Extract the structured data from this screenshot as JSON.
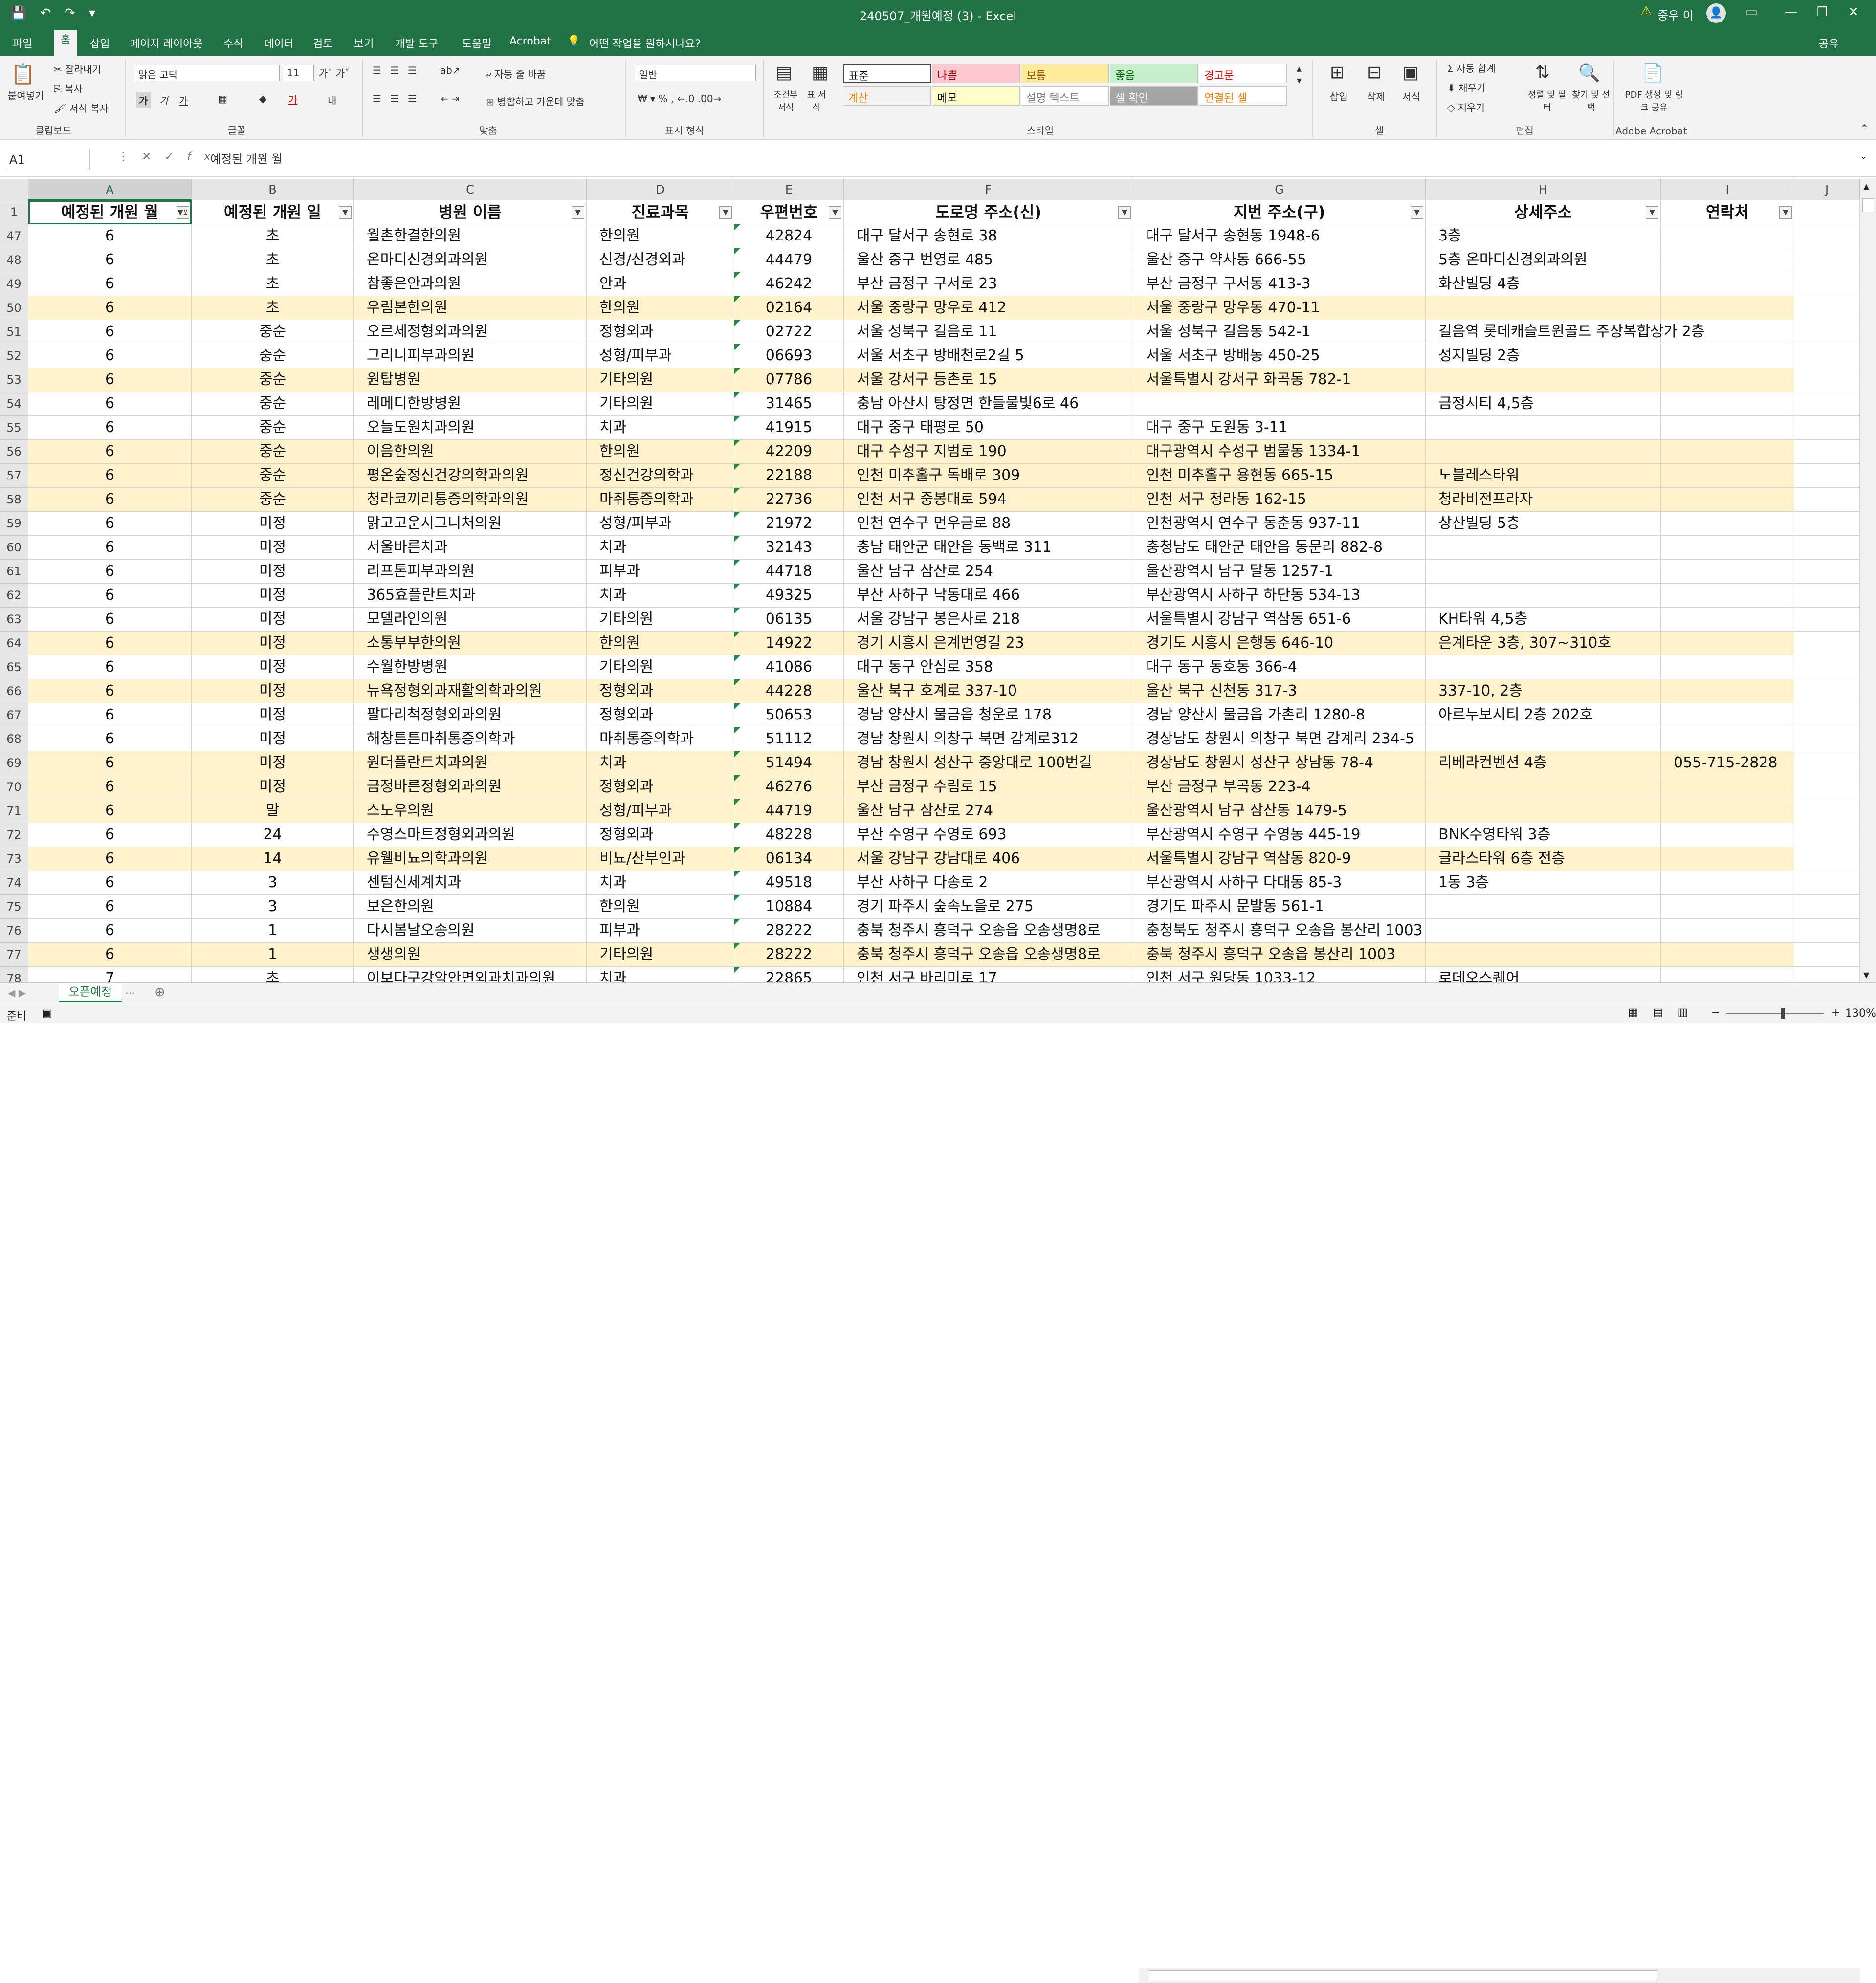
{
  "window": {
    "title": "240507_개원예정 (3)  -  Excel",
    "user": "중우 이",
    "qat_icons": [
      "save-icon",
      "undo-icon",
      "redo-icon"
    ]
  },
  "menu": [
    "파일",
    "홈",
    "삽입",
    "페이지 레이아웃",
    "수식",
    "데이터",
    "검토",
    "보기",
    "개발 도구",
    "도움말",
    "Acrobat",
    "어떤 작업을 원하시나요?",
    "공유"
  ],
  "ribbon": {
    "clipboard": {
      "paste": "붙여넣기",
      "cut": "잘라내기",
      "copy": "복사",
      "format_painter": "서식 복사",
      "group": "클립보드"
    },
    "font": {
      "name": "맑은 고딕",
      "size": "11",
      "group": "글꼴"
    },
    "align": {
      "wrap": "자동 줄 바꿈",
      "merge": "병합하고 가운데 맞춤",
      "group": "맞춤"
    },
    "number": {
      "format": "일반",
      "group": "표시 형식"
    },
    "styles": {
      "cond": "조건부 서식",
      "table": "표 서식",
      "group": "스타일",
      "cells": [
        {
          "label": "표준",
          "bg": "#ffffff",
          "fg": "#000000"
        },
        {
          "label": "나쁨",
          "bg": "#ffc7ce",
          "fg": "#9c0006"
        },
        {
          "label": "보통",
          "bg": "#ffeb9c",
          "fg": "#9c5700"
        },
        {
          "label": "좋음",
          "bg": "#c6efce",
          "fg": "#006100"
        },
        {
          "label": "경고문",
          "bg": "#ffffff",
          "fg": "#ff0000"
        },
        {
          "label": "계산",
          "bg": "#f2f2f2",
          "fg": "#fa7d00"
        },
        {
          "label": "메모",
          "bg": "#ffffcc",
          "fg": "#000000"
        },
        {
          "label": "설명 텍스트",
          "bg": "#ffffff",
          "fg": "#7f7f7f"
        },
        {
          "label": "셀 확인",
          "bg": "#a5a5a5",
          "fg": "#ffffff"
        },
        {
          "label": "연결된 셀",
          "bg": "#ffffff",
          "fg": "#fa7d00"
        }
      ]
    },
    "cells": {
      "insert": "삽입",
      "delete": "삭제",
      "format": "서식",
      "group": "셀"
    },
    "editing": {
      "autosum": "자동 합계",
      "fill": "채우기",
      "clear": "지우기",
      "sort": "정렬 및 필터",
      "find": "찾기 및 선택",
      "group": "편집"
    },
    "acrobat": {
      "pdf": "PDF 생성 및 링크 공유",
      "group": "Adobe Acrobat"
    }
  },
  "formula_bar": {
    "name_box": "A1",
    "formula": "예정된 개원 월"
  },
  "columns": [
    "A",
    "B",
    "C",
    "D",
    "E",
    "F",
    "G",
    "H",
    "I",
    "J"
  ],
  "headers": [
    "예정된 개원 월",
    "예정된 개원 일",
    "병원 이름",
    "진료과목",
    "우편번호",
    "도로명 주소(신)",
    "지번 주소(구)",
    "상세주소",
    "연락처"
  ],
  "rows": [
    {
      "n": "47",
      "hl": false,
      "c": [
        "6",
        "초",
        "월촌한결한의원",
        "한의원",
        "42824",
        "대구 달서구 송현로 38",
        "대구 달서구 송현동 1948-6",
        "3층",
        ""
      ]
    },
    {
      "n": "48",
      "hl": false,
      "c": [
        "6",
        "초",
        "온마디신경외과의원",
        "신경/신경외과",
        "44479",
        "울산 중구 번영로 485",
        "울산 중구 약사동 666-55",
        "5층 온마디신경외과의원",
        ""
      ]
    },
    {
      "n": "49",
      "hl": false,
      "c": [
        "6",
        "초",
        "참좋은안과의원",
        "안과",
        "46242",
        "부산 금정구 구서로 23",
        "부산 금정구 구서동 413-3",
        "화산빌딩 4층",
        ""
      ]
    },
    {
      "n": "50",
      "hl": true,
      "c": [
        "6",
        "초",
        "우림본한의원",
        "한의원",
        "02164",
        "서울 중랑구 망우로 412",
        "서울 중랑구 망우동 470-11",
        "",
        ""
      ]
    },
    {
      "n": "51",
      "hl": false,
      "c": [
        "6",
        "중순",
        "오르세정형외과의원",
        "정형외과",
        "02722",
        "서울 성북구 길음로 11",
        "서울 성북구 길음동 542-1",
        "길음역 롯데캐슬트윈골드 주상복합상가 2층",
        ""
      ]
    },
    {
      "n": "52",
      "hl": false,
      "c": [
        "6",
        "중순",
        "그리니피부과의원",
        "성형/피부과",
        "06693",
        "서울 서초구 방배천로2길 5",
        "서울 서초구 방배동 450-25",
        "성지빌딩 2층",
        ""
      ]
    },
    {
      "n": "53",
      "hl": true,
      "c": [
        "6",
        "중순",
        "원탑병원",
        "기타의원",
        "07786",
        "서울 강서구 등촌로 15",
        "서울특별시 강서구 화곡동 782-1",
        "",
        ""
      ]
    },
    {
      "n": "54",
      "hl": false,
      "c": [
        "6",
        "중순",
        "레메디한방병원",
        "기타의원",
        "31465",
        "충남 아산시 탕정면 한들물빛6로 46",
        "",
        "금정시티 4,5층",
        ""
      ]
    },
    {
      "n": "55",
      "hl": false,
      "c": [
        "6",
        "중순",
        "오늘도원치과의원",
        "치과",
        "41915",
        "대구 중구 태평로 50",
        "대구 중구 도원동 3-11",
        "",
        ""
      ]
    },
    {
      "n": "56",
      "hl": true,
      "c": [
        "6",
        "중순",
        "이음한의원",
        "한의원",
        "42209",
        "대구 수성구 지범로 190",
        "대구광역시 수성구 범물동 1334-1",
        "",
        ""
      ]
    },
    {
      "n": "57",
      "hl": true,
      "c": [
        "6",
        "중순",
        "평온숲정신건강의학과의원",
        "정신건강의학과",
        "22188",
        "인천 미추홀구 독배로 309",
        "인천 미추홀구 용현동 665-15",
        "노블레스타워",
        ""
      ]
    },
    {
      "n": "58",
      "hl": true,
      "c": [
        "6",
        "중순",
        "청라코끼리통증의학과의원",
        "마취통증의학과",
        "22736",
        "인천 서구 중봉대로 594",
        "인천 서구 청라동 162-15",
        "청라비전프라자",
        ""
      ]
    },
    {
      "n": "59",
      "hl": false,
      "c": [
        "6",
        "미정",
        "맑고고운시그니처의원",
        "성형/피부과",
        "21972",
        "인천 연수구 먼우금로 88",
        "인천광역시 연수구 동춘동 937-11",
        "상산빌딩 5층",
        ""
      ]
    },
    {
      "n": "60",
      "hl": false,
      "c": [
        "6",
        "미정",
        "서울바른치과",
        "치과",
        "32143",
        "충남 태안군 태안읍 동백로 311",
        "충청남도 태안군 태안읍 동문리 882-8",
        "",
        ""
      ]
    },
    {
      "n": "61",
      "hl": false,
      "c": [
        "6",
        "미정",
        "리프톤피부과의원",
        "피부과",
        "44718",
        "울산 남구 삼산로 254",
        "울산광역시 남구 달동 1257-1",
        "",
        ""
      ]
    },
    {
      "n": "62",
      "hl": false,
      "c": [
        "6",
        "미정",
        "365효플란트치과",
        "치과",
        "49325",
        "부산 사하구 낙동대로 466",
        "부산광역시 사하구 하단동 534-13",
        "",
        ""
      ]
    },
    {
      "n": "63",
      "hl": false,
      "c": [
        "6",
        "미정",
        "모델라인의원",
        "기타의원",
        "06135",
        "서울 강남구 봉은사로 218",
        "서울특별시 강남구 역삼동 651-6",
        "KH타워 4,5층",
        ""
      ]
    },
    {
      "n": "64",
      "hl": true,
      "c": [
        "6",
        "미정",
        "소통부부한의원",
        "한의원",
        "14922",
        "경기 시흥시 은계번영길 23",
        "경기도 시흥시 은행동 646-10",
        "은계타운 3층, 307~310호",
        ""
      ]
    },
    {
      "n": "65",
      "hl": false,
      "c": [
        "6",
        "미정",
        "수월한방병원",
        "기타의원",
        "41086",
        "대구 동구 안심로 358",
        "대구 동구 동호동 366-4",
        "",
        ""
      ]
    },
    {
      "n": "66",
      "hl": true,
      "c": [
        "6",
        "미정",
        "뉴욕정형외과재활의학과의원",
        "정형외과",
        "44228",
        "울산 북구 호계로 337-10",
        "울산 북구 신천동 317-3",
        "337-10, 2층",
        ""
      ]
    },
    {
      "n": "67",
      "hl": false,
      "c": [
        "6",
        "미정",
        "팔다리척정형외과의원",
        "정형외과",
        "50653",
        "경남 양산시 물금읍 청운로 178",
        "경남 양산시 물금읍 가촌리 1280-8",
        "아르누보시티 2층 202호",
        ""
      ]
    },
    {
      "n": "68",
      "hl": false,
      "c": [
        "6",
        "미정",
        "해창튼튼마취통증의학과",
        "마취통증의학과",
        "51112",
        "경남 창원시 의창구 북면 감계로312",
        "경상남도 창원시 의창구 북면 감계리 234-5",
        "",
        ""
      ]
    },
    {
      "n": "69",
      "hl": true,
      "c": [
        "6",
        "미정",
        "원더플란트치과의원",
        "치과",
        "51494",
        "경남 창원시 성산구 중앙대로 100번길",
        "경상남도 창원시 성산구 상남동 78-4",
        "리베라컨벤션 4층",
        "055-715-2828"
      ]
    },
    {
      "n": "70",
      "hl": true,
      "c": [
        "6",
        "미정",
        "금정바른정형외과의원",
        "정형외과",
        "46276",
        "부산 금정구 수림로 15",
        "부산 금정구 부곡동 223-4",
        "",
        ""
      ]
    },
    {
      "n": "71",
      "hl": true,
      "c": [
        "6",
        "말",
        "스노우의원",
        "성형/피부과",
        "44719",
        "울산 남구 삼산로 274",
        "울산광역시 남구 삼산동 1479-5",
        "",
        ""
      ]
    },
    {
      "n": "72",
      "hl": false,
      "c": [
        "6",
        "24",
        "수영스마트정형외과의원",
        "정형외과",
        "48228",
        "부산 수영구 수영로 693",
        "부산광역시 수영구 수영동 445-19",
        "BNK수영타워 3층",
        ""
      ]
    },
    {
      "n": "73",
      "hl": true,
      "c": [
        "6",
        "14",
        "유웰비뇨의학과의원",
        "비뇨/산부인과",
        "06134",
        "서울 강남구 강남대로 406",
        "서울특별시 강남구 역삼동 820-9",
        "글라스타워 6층 전층",
        ""
      ]
    },
    {
      "n": "74",
      "hl": false,
      "c": [
        "6",
        "3",
        "센텀신세계치과",
        "치과",
        "49518",
        "부산 사하구 다송로 2",
        "부산광역시 사하구 다대동 85-3",
        "1동 3층",
        ""
      ]
    },
    {
      "n": "75",
      "hl": false,
      "c": [
        "6",
        "3",
        "보은한의원",
        "한의원",
        "10884",
        "경기 파주시 숲속노을로 275",
        "경기도 파주시 문발동 561-1",
        "",
        ""
      ]
    },
    {
      "n": "76",
      "hl": false,
      "c": [
        "6",
        "1",
        "다시봄날오송의원",
        "피부과",
        "28222",
        "충북 청주시 흥덕구 오송읍 오송생명8로",
        "충청북도 청주시 흥덕구 오송읍 봉산리 1003",
        "",
        ""
      ]
    },
    {
      "n": "77",
      "hl": true,
      "c": [
        "6",
        "1",
        "생생의원",
        "기타의원",
        "28222",
        "충북 청주시 흥덕구 오송읍 오송생명8로",
        "충북 청주시 흥덕구 오송읍 봉산리 1003",
        "",
        ""
      ]
    },
    {
      "n": "78",
      "hl": false,
      "c": [
        "7",
        "초",
        "이보다구강악안면외과치과의원",
        "치과",
        "22865",
        "인천 서구 바리미로 17",
        "인천 서구 원당동 1033-12",
        "로데오스퀘어",
        ""
      ]
    }
  ],
  "sheet_tab": "오픈예정",
  "status": {
    "ready": "준비",
    "zoom": "130%"
  }
}
